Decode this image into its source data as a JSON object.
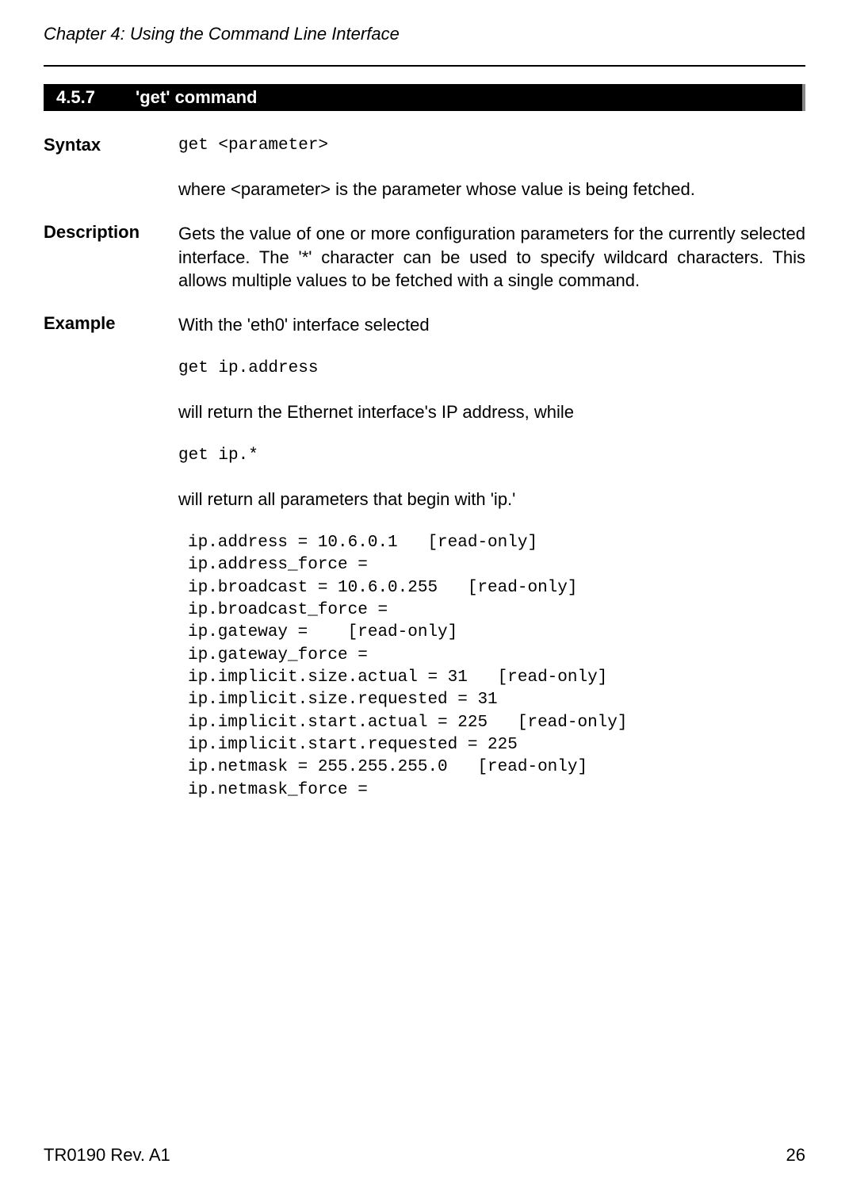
{
  "header": {
    "chapter": "Chapter 4: Using the Command Line Interface"
  },
  "section": {
    "number": "4.5.7",
    "title": "'get' command"
  },
  "syntax": {
    "label": "Syntax",
    "code": "get <parameter>",
    "desc": "where <parameter> is the parameter whose value is being fetched."
  },
  "description": {
    "label": "Description",
    "text": "Gets the value of one or more configuration parameters for the currently selected interface. The '*' character can be used to specify wildcard characters. This allows multiple values to be fetched with a single command."
  },
  "example": {
    "label": "Example",
    "intro": "With the 'eth0' interface selected",
    "cmd1": "get ip.address",
    "result1": "will return the Ethernet interface's IP address, while",
    "cmd2": "get ip.*",
    "result2": "will return all parameters that begin with 'ip.'",
    "output": "ip.address = 10.6.0.1   [read-only]\nip.address_force = \nip.broadcast = 10.6.0.255   [read-only]\nip.broadcast_force = \nip.gateway =    [read-only]\nip.gateway_force = \nip.implicit.size.actual = 31   [read-only]\nip.implicit.size.requested = 31\nip.implicit.start.actual = 225   [read-only]\nip.implicit.start.requested = 225\nip.netmask = 255.255.255.0   [read-only]\nip.netmask_force = "
  },
  "footer": {
    "left": "TR0190 Rev. A1",
    "right": "26"
  }
}
